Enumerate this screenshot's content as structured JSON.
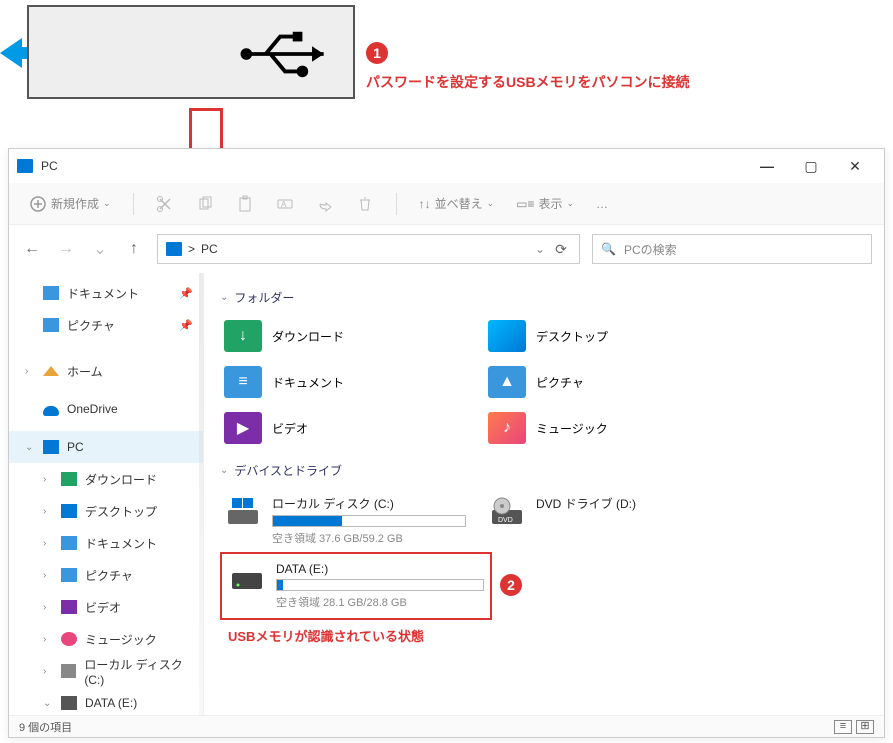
{
  "annotations": {
    "marker1": "1",
    "caption1": "パスワードを設定するUSBメモリをパソコンに接続",
    "marker2": "2",
    "caption2": "USBメモリが認識されている状態"
  },
  "window": {
    "title": "PC",
    "toolbar": {
      "new": "新規作成",
      "sort": "並べ替え",
      "view": "表示",
      "more": "…"
    },
    "nav": {
      "breadcrumb_sep": ">",
      "breadcrumb": "PC",
      "search_placeholder": "PCの検索"
    },
    "sidebar": {
      "quick": [
        {
          "label": "ドキュメント",
          "pinned": true
        },
        {
          "label": "ピクチャ",
          "pinned": true
        }
      ],
      "home": "ホーム",
      "onedrive": "OneDrive",
      "pc": "PC",
      "pc_children": [
        "ダウンロード",
        "デスクトップ",
        "ドキュメント",
        "ピクチャ",
        "ビデオ",
        "ミュージック",
        "ローカル ディスク (C:)",
        "DATA (E:)"
      ]
    },
    "content": {
      "folders_header": "フォルダー",
      "folders": [
        {
          "label": "ダウンロード",
          "cls": "fic-dl",
          "glyph": "↓"
        },
        {
          "label": "デスクトップ",
          "cls": "fic-desk",
          "glyph": ""
        },
        {
          "label": "ドキュメント",
          "cls": "fic-doc",
          "glyph": "≡"
        },
        {
          "label": "ピクチャ",
          "cls": "fic-pic",
          "glyph": "▲"
        },
        {
          "label": "ビデオ",
          "cls": "fic-vid",
          "glyph": "▶"
        },
        {
          "label": "ミュージック",
          "cls": "fic-mus",
          "glyph": "♪"
        }
      ],
      "devices_header": "デバイスとドライブ",
      "drive_c": {
        "name": "ローカル ディスク (C:)",
        "space": "空き領域 37.6 GB/59.2 GB",
        "fill_pct": 36
      },
      "drive_dvd": {
        "name": "DVD ドライブ (D:)"
      },
      "drive_e": {
        "name": "DATA (E:)",
        "space": "空き領域 28.1 GB/28.8 GB",
        "fill_pct": 3
      }
    },
    "status": "9 個の項目"
  }
}
